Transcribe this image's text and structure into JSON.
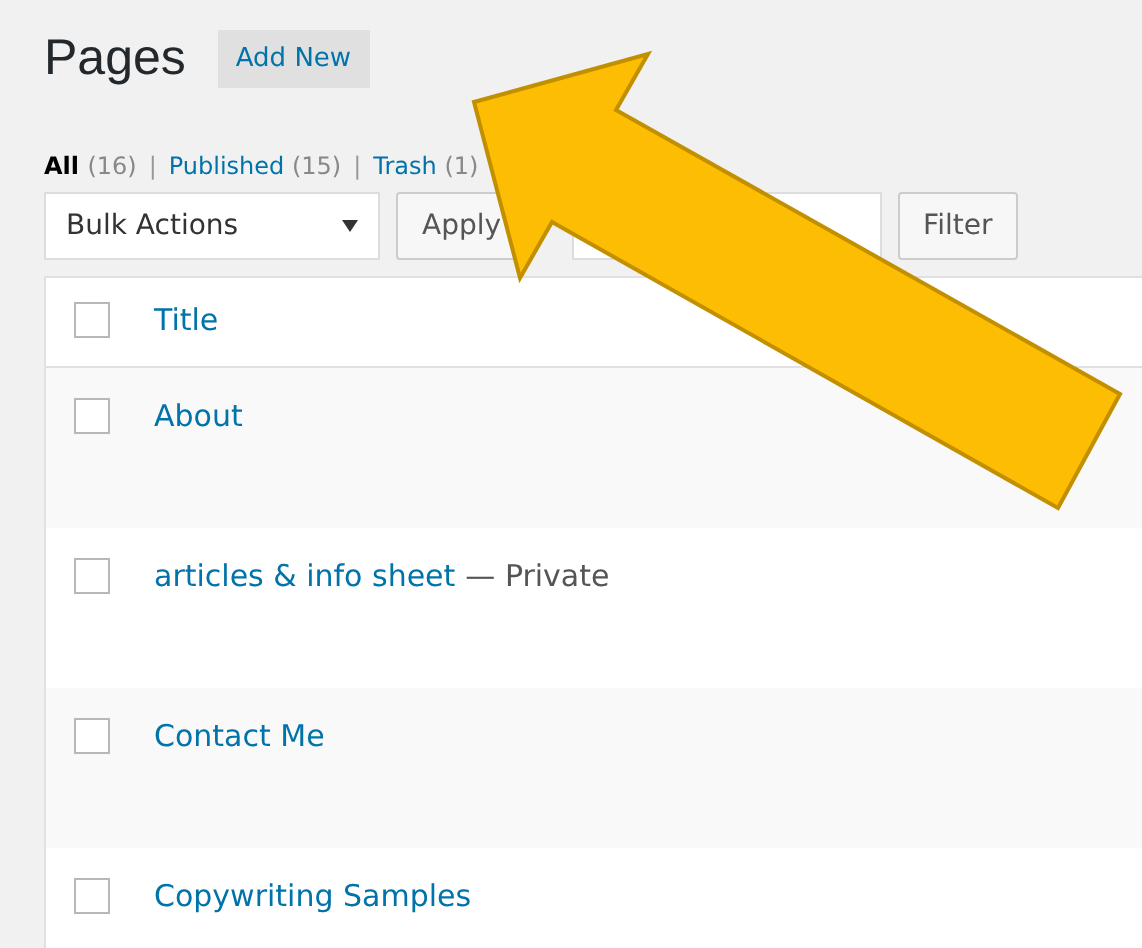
{
  "page_title": "Pages",
  "add_new_button": "Add New",
  "filters": [
    {
      "label": "All",
      "count": "(16)",
      "selected": true
    },
    {
      "label": "Published",
      "count": "(15)",
      "selected": false
    },
    {
      "label": "Trash",
      "count": "(1)",
      "selected": false
    }
  ],
  "separator": "|",
  "bulk_actions": {
    "value": "Bulk Actions"
  },
  "apply_button": "Apply",
  "filter_button": "Filter",
  "table": {
    "columns": [
      "Title"
    ],
    "select_all_checked": false,
    "rows": [
      {
        "title": "About",
        "checked": false
      },
      {
        "title": "articles & info sheet",
        "state": "— Private",
        "checked": false
      },
      {
        "title": "Contact Me",
        "checked": false
      },
      {
        "title": "Copywriting Samples",
        "checked": false
      }
    ]
  }
}
